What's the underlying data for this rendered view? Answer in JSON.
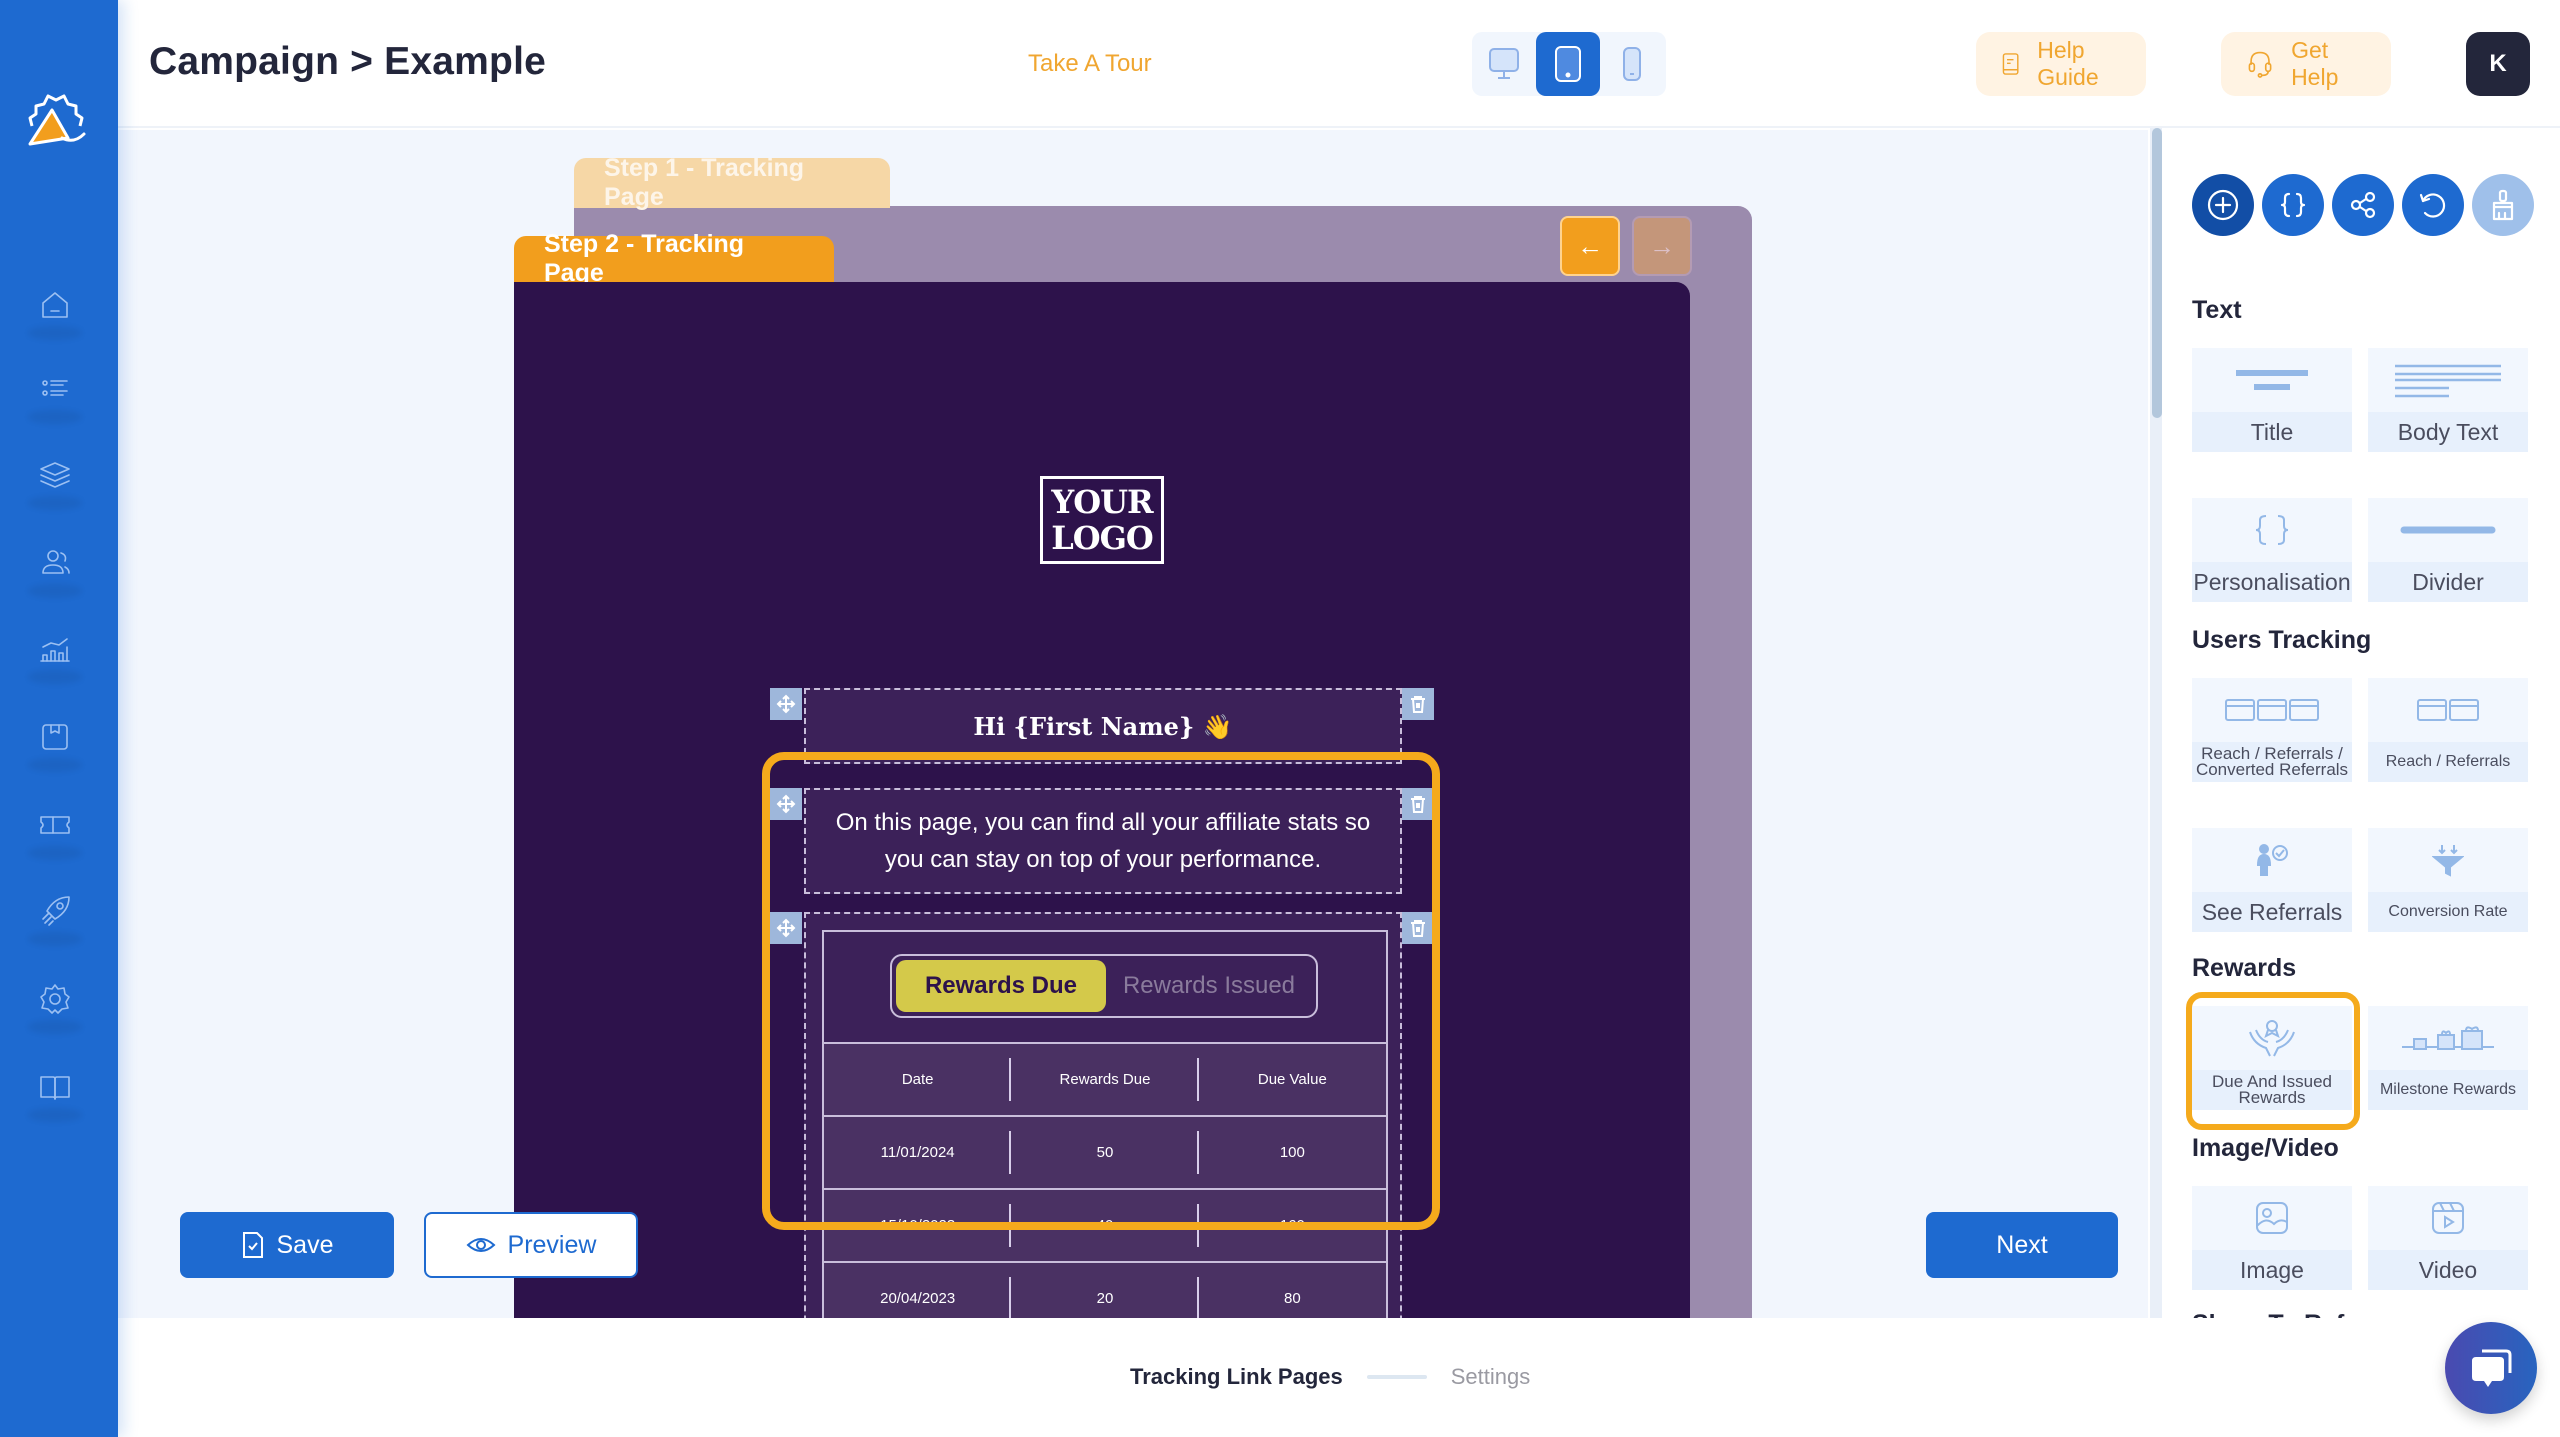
{
  "header": {
    "title": "Campaign > Example",
    "tour_label": "Take A Tour",
    "device_modes": [
      {
        "name": "desktop",
        "active": false
      },
      {
        "name": "tablet",
        "active": true
      },
      {
        "name": "mobile",
        "active": false
      }
    ],
    "help_guide_label": "Help Guide",
    "get_help_label": "Get Help",
    "avatar_initial": "K"
  },
  "sidebar": {
    "items": [
      {
        "icon": "home-icon"
      },
      {
        "icon": "list-icon"
      },
      {
        "icon": "layers-icon"
      },
      {
        "icon": "users-icon"
      },
      {
        "icon": "analytics-icon"
      },
      {
        "icon": "box-icon"
      },
      {
        "icon": "ticket-icon"
      },
      {
        "icon": "rocket-icon"
      },
      {
        "icon": "settings-icon"
      },
      {
        "icon": "book-icon"
      }
    ]
  },
  "canvas": {
    "step1_tab": "Step 1 - Tracking Page",
    "step2_tab": "Step 2 - Tracking Page",
    "prev_arrow": "←",
    "next_arrow": "→",
    "logo_line1": "YOUR",
    "logo_line2": "LOGO",
    "greeting": "Hi {First Name} 👋",
    "intro_text": "On this page, you can find all your affiliate stats so you can stay on top of your performance.",
    "rewards": {
      "toggle_due": "Rewards Due",
      "toggle_issued": "Rewards Issued",
      "columns": [
        "Date",
        "Rewards Due",
        "Due Value"
      ],
      "rows": [
        [
          "11/01/2024",
          "50",
          "100"
        ],
        [
          "15/10/2023",
          "40",
          "160"
        ],
        [
          "20/04/2023",
          "20",
          "80"
        ]
      ]
    }
  },
  "actions": {
    "save_label": "Save",
    "preview_label": "Preview",
    "next_label": "Next"
  },
  "right_panel": {
    "tools": [
      "add-icon",
      "variables-icon",
      "share-icon",
      "undo-icon",
      "clear-format-icon"
    ],
    "sections": {
      "text": {
        "heading": "Text",
        "items": [
          "Title",
          "Body Text",
          "Personalisation",
          "Divider"
        ]
      },
      "users_tracking": {
        "heading": "Users Tracking",
        "items": [
          "Reach / Referrals / Converted Referrals",
          "Reach / Referrals",
          "See Referrals",
          "Conversion Rate"
        ]
      },
      "rewards": {
        "heading": "Rewards",
        "items": [
          "Due And Issued Rewards",
          "Milestone Rewards"
        ]
      },
      "image_video": {
        "heading": "Image/Video",
        "items": [
          "Image",
          "Video"
        ]
      },
      "share": {
        "heading": "Share To Refer"
      }
    }
  },
  "stepper": {
    "current": "Tracking Link Pages",
    "next": "Settings"
  },
  "colors": {
    "primary": "#1e6ad0",
    "accent": "#f29e1d",
    "canvas_bg": "#2d124b",
    "highlight": "#f5aa1c"
  }
}
